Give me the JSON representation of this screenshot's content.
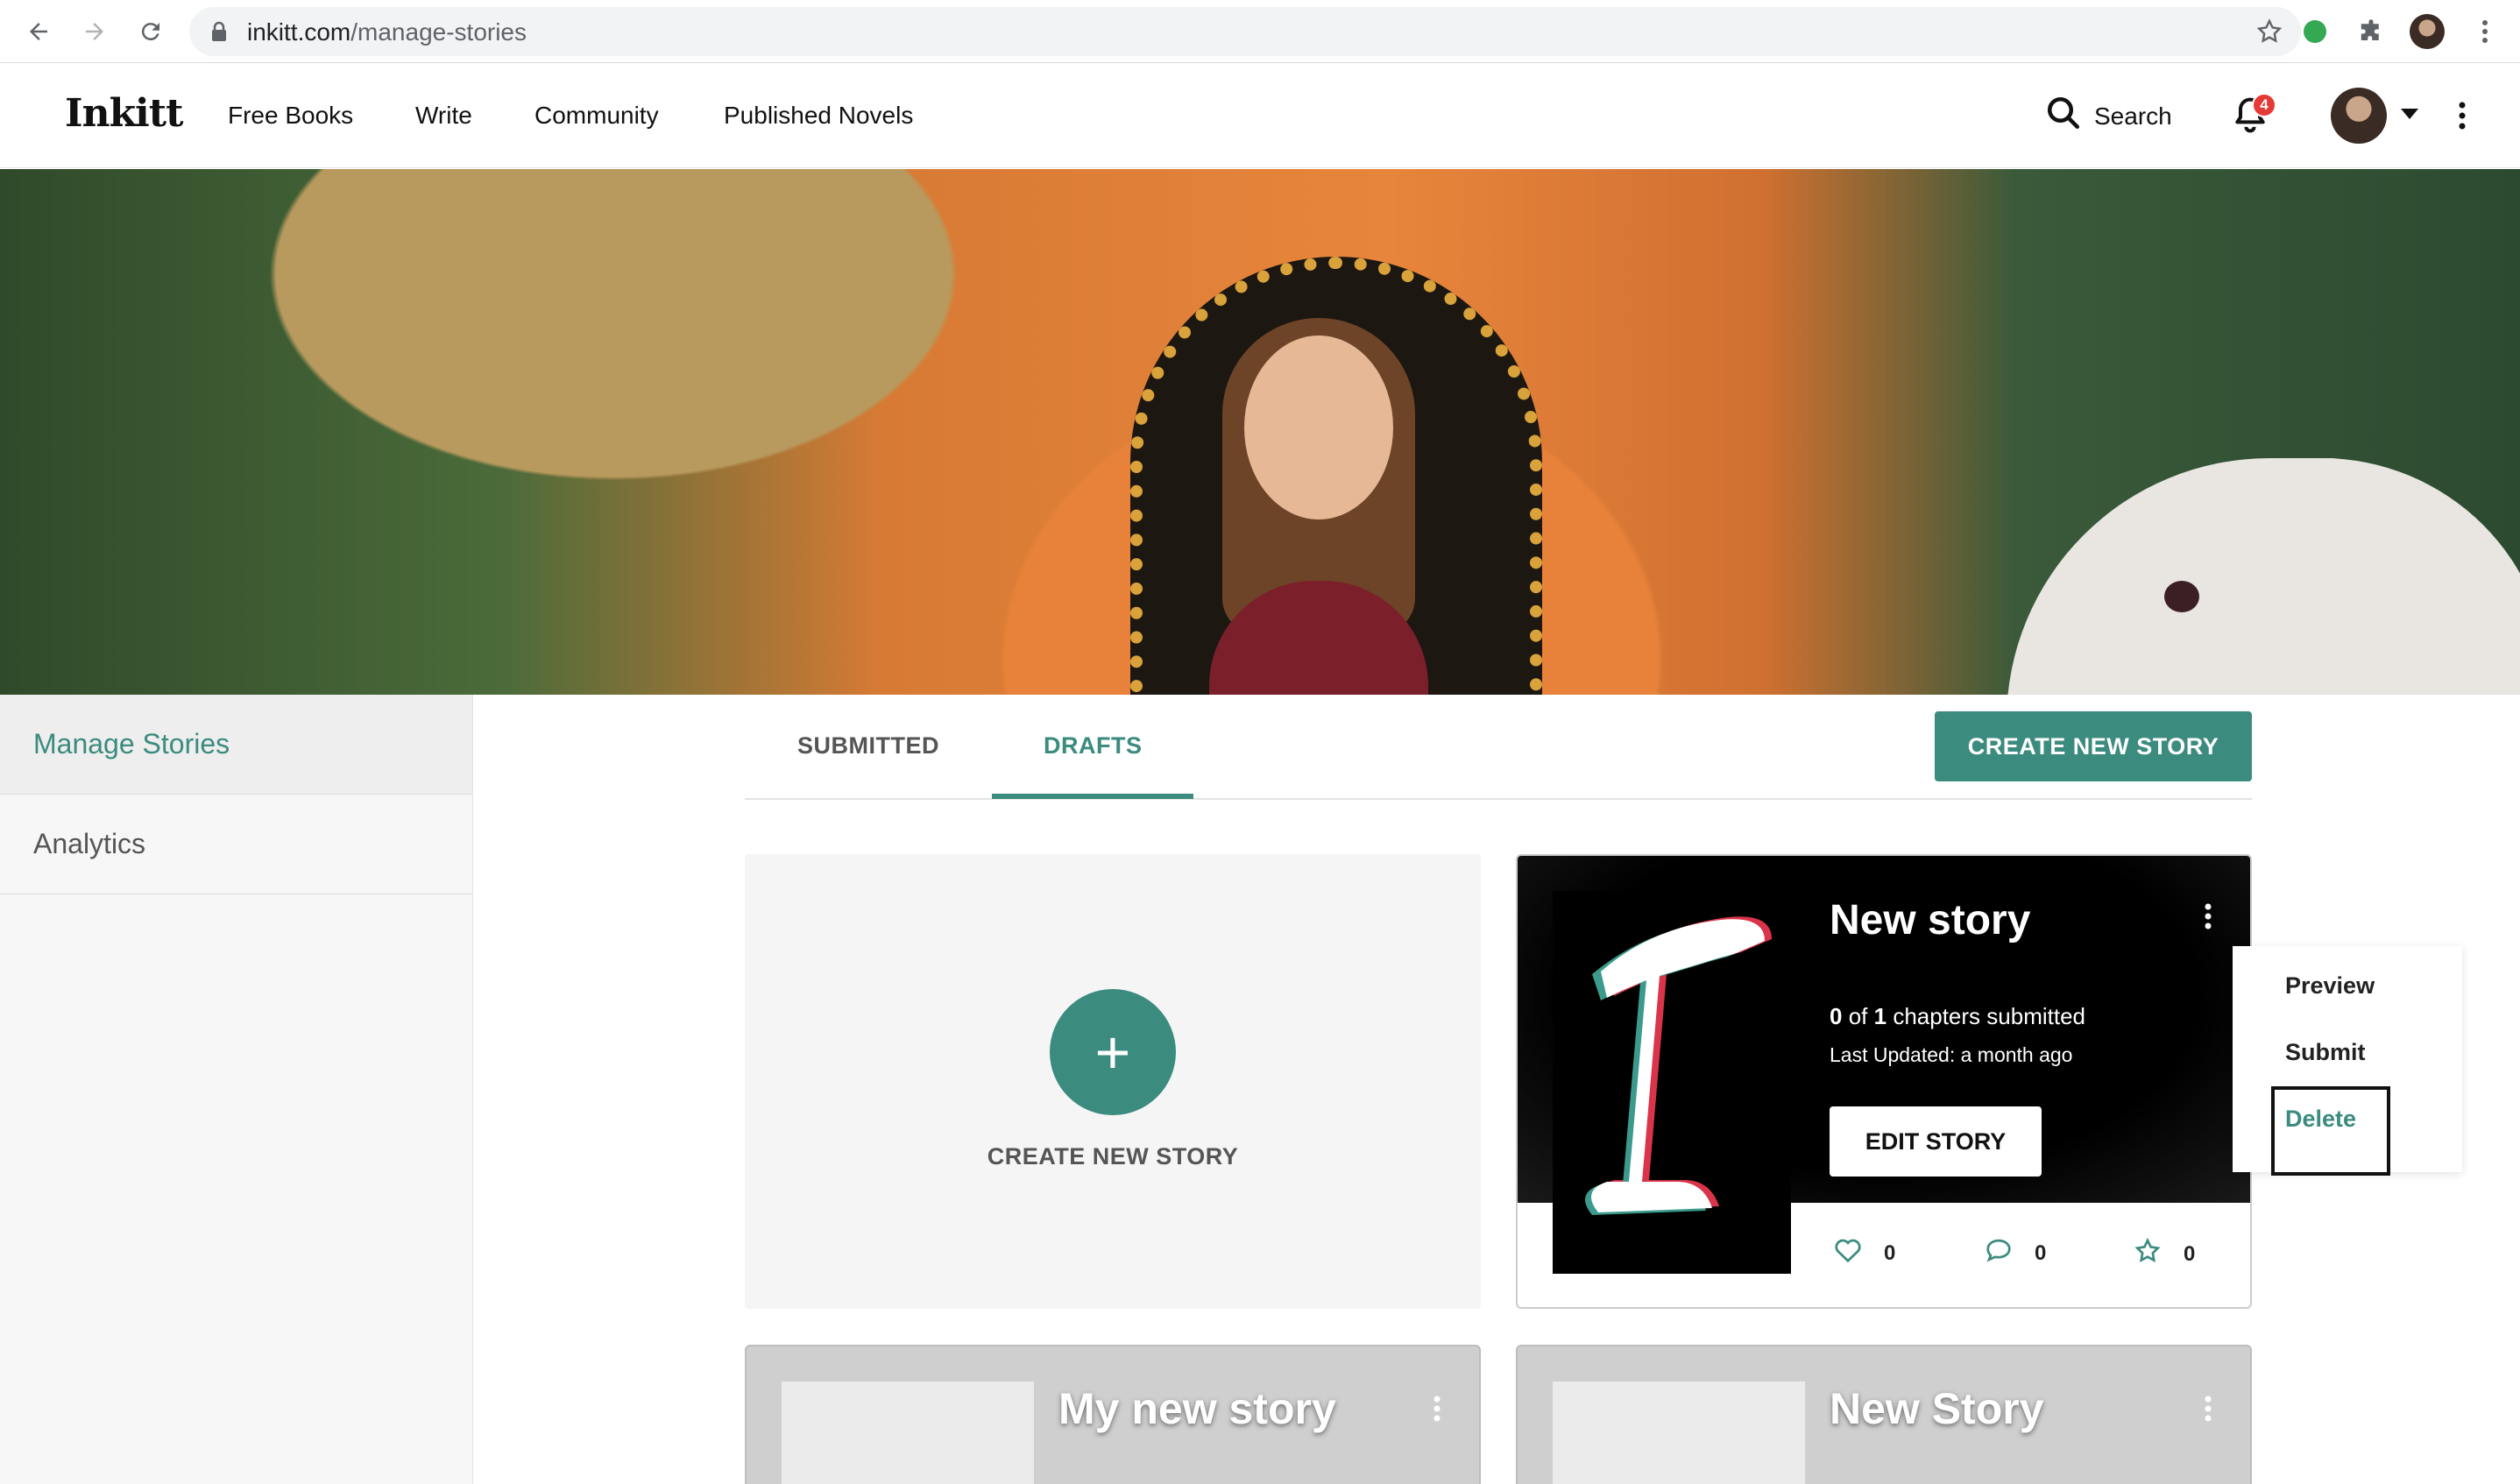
{
  "browser": {
    "url_domain": "inkitt.com",
    "url_path": "/manage-stories"
  },
  "header": {
    "logo": "Inkitt",
    "nav": [
      "Free Books",
      "Write",
      "Community",
      "Published Novels"
    ],
    "search_label": "Search",
    "notification_count": "4"
  },
  "sidebar": {
    "items": [
      {
        "label": "Manage Stories",
        "active": true
      },
      {
        "label": "Analytics",
        "active": false
      }
    ]
  },
  "tabs": [
    {
      "label": "SUBMITTED",
      "active": false
    },
    {
      "label": "DRAFTS",
      "active": true
    }
  ],
  "create_button_label": "CREATE NEW STORY",
  "create_card_label": "CREATE NEW STORY",
  "story": {
    "title": "New story",
    "chapters_submitted": "0",
    "chapters_total": "1",
    "chapters_of": "of",
    "chapters_suffix": "chapters submitted",
    "last_updated": "Last Updated: a month ago",
    "edit_label": "EDIT STORY",
    "likes": "0",
    "comments": "0",
    "stars": "0"
  },
  "story_menu": {
    "items": [
      "Preview",
      "Submit",
      "Delete"
    ]
  },
  "more_stories": [
    {
      "title": "My new story"
    },
    {
      "title": "New Story"
    }
  ],
  "colors": {
    "accent": "#3b8b7f",
    "badge": "#e53935"
  }
}
